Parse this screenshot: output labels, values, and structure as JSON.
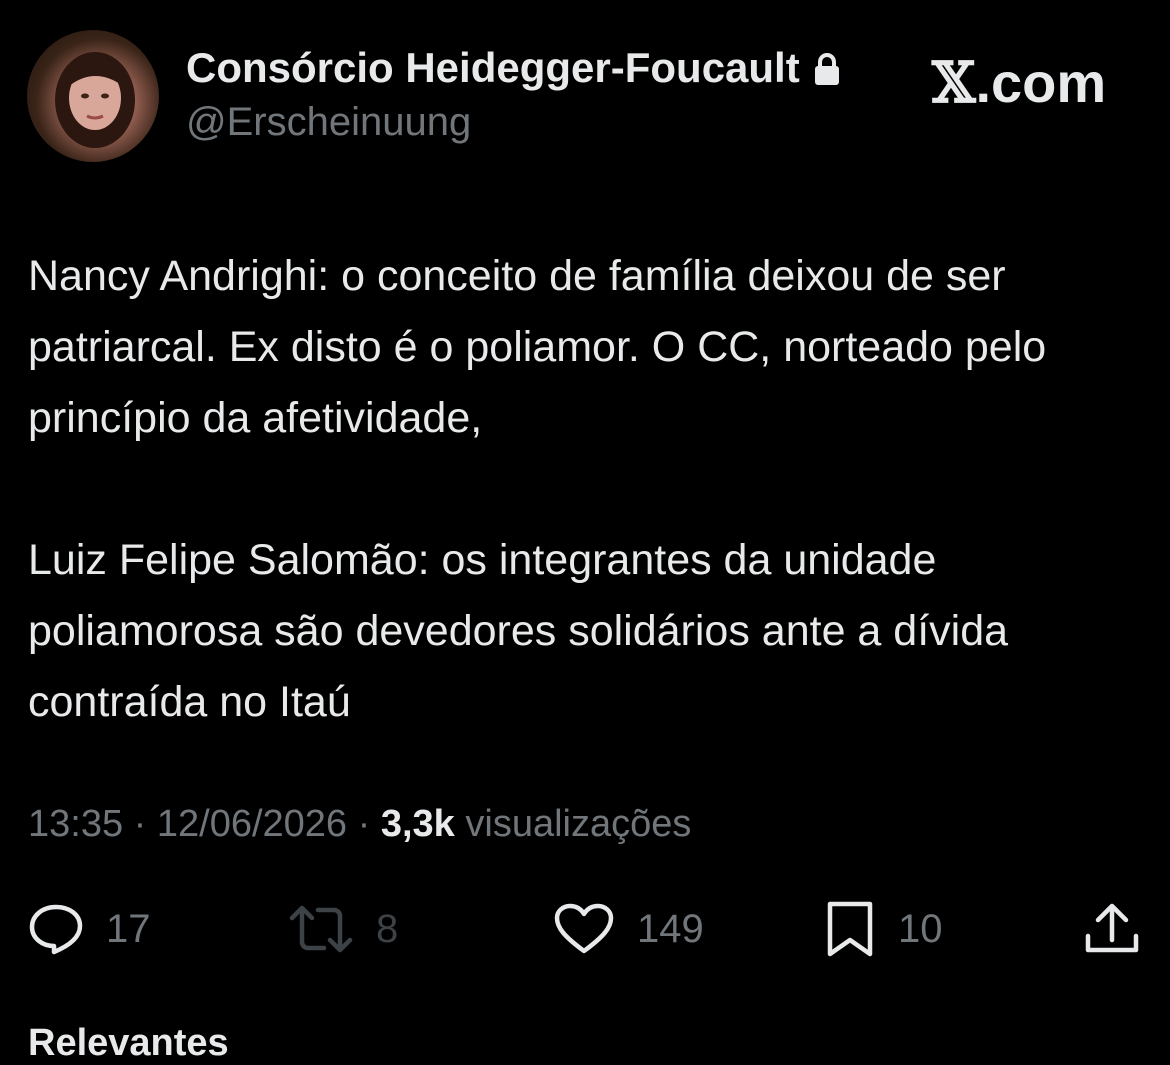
{
  "author": {
    "display_name": "Consórcio Heidegger-Foucault",
    "handle": "@Erscheinuung",
    "avatar": "profile-photo",
    "protected_icon": "lock-icon"
  },
  "brand": {
    "logo": "𝕏",
    "suffix": ".com"
  },
  "tweet": {
    "paragraphs": [
      "Nancy Andrighi: o conceito de família deixou de ser patriarcal. Ex disto é o poliamor. O CC, norteado pelo princípio da afetividade,",
      "Luiz Felipe Salomão: os integrantes da unidade poliamorosa são devedores solidários ante a dívida contraída no Itaú"
    ]
  },
  "meta": {
    "time": "13:35",
    "separator": " · ",
    "date": "12/06/2026",
    "views_count": "3,3k",
    "views_label": "visualizações"
  },
  "actions": {
    "reply": {
      "icon": "reply-icon",
      "count": "17"
    },
    "retweet": {
      "icon": "retweet-icon",
      "count": "8"
    },
    "like": {
      "icon": "heart-icon",
      "count": "149"
    },
    "bookmark": {
      "icon": "bookmark-icon",
      "count": "10"
    },
    "share": {
      "icon": "share-icon"
    }
  },
  "footer": {
    "section_label": "Relevantes"
  },
  "colors": {
    "background": "#000000",
    "primary_text": "#e7e9ea",
    "secondary_text": "#71767b"
  }
}
